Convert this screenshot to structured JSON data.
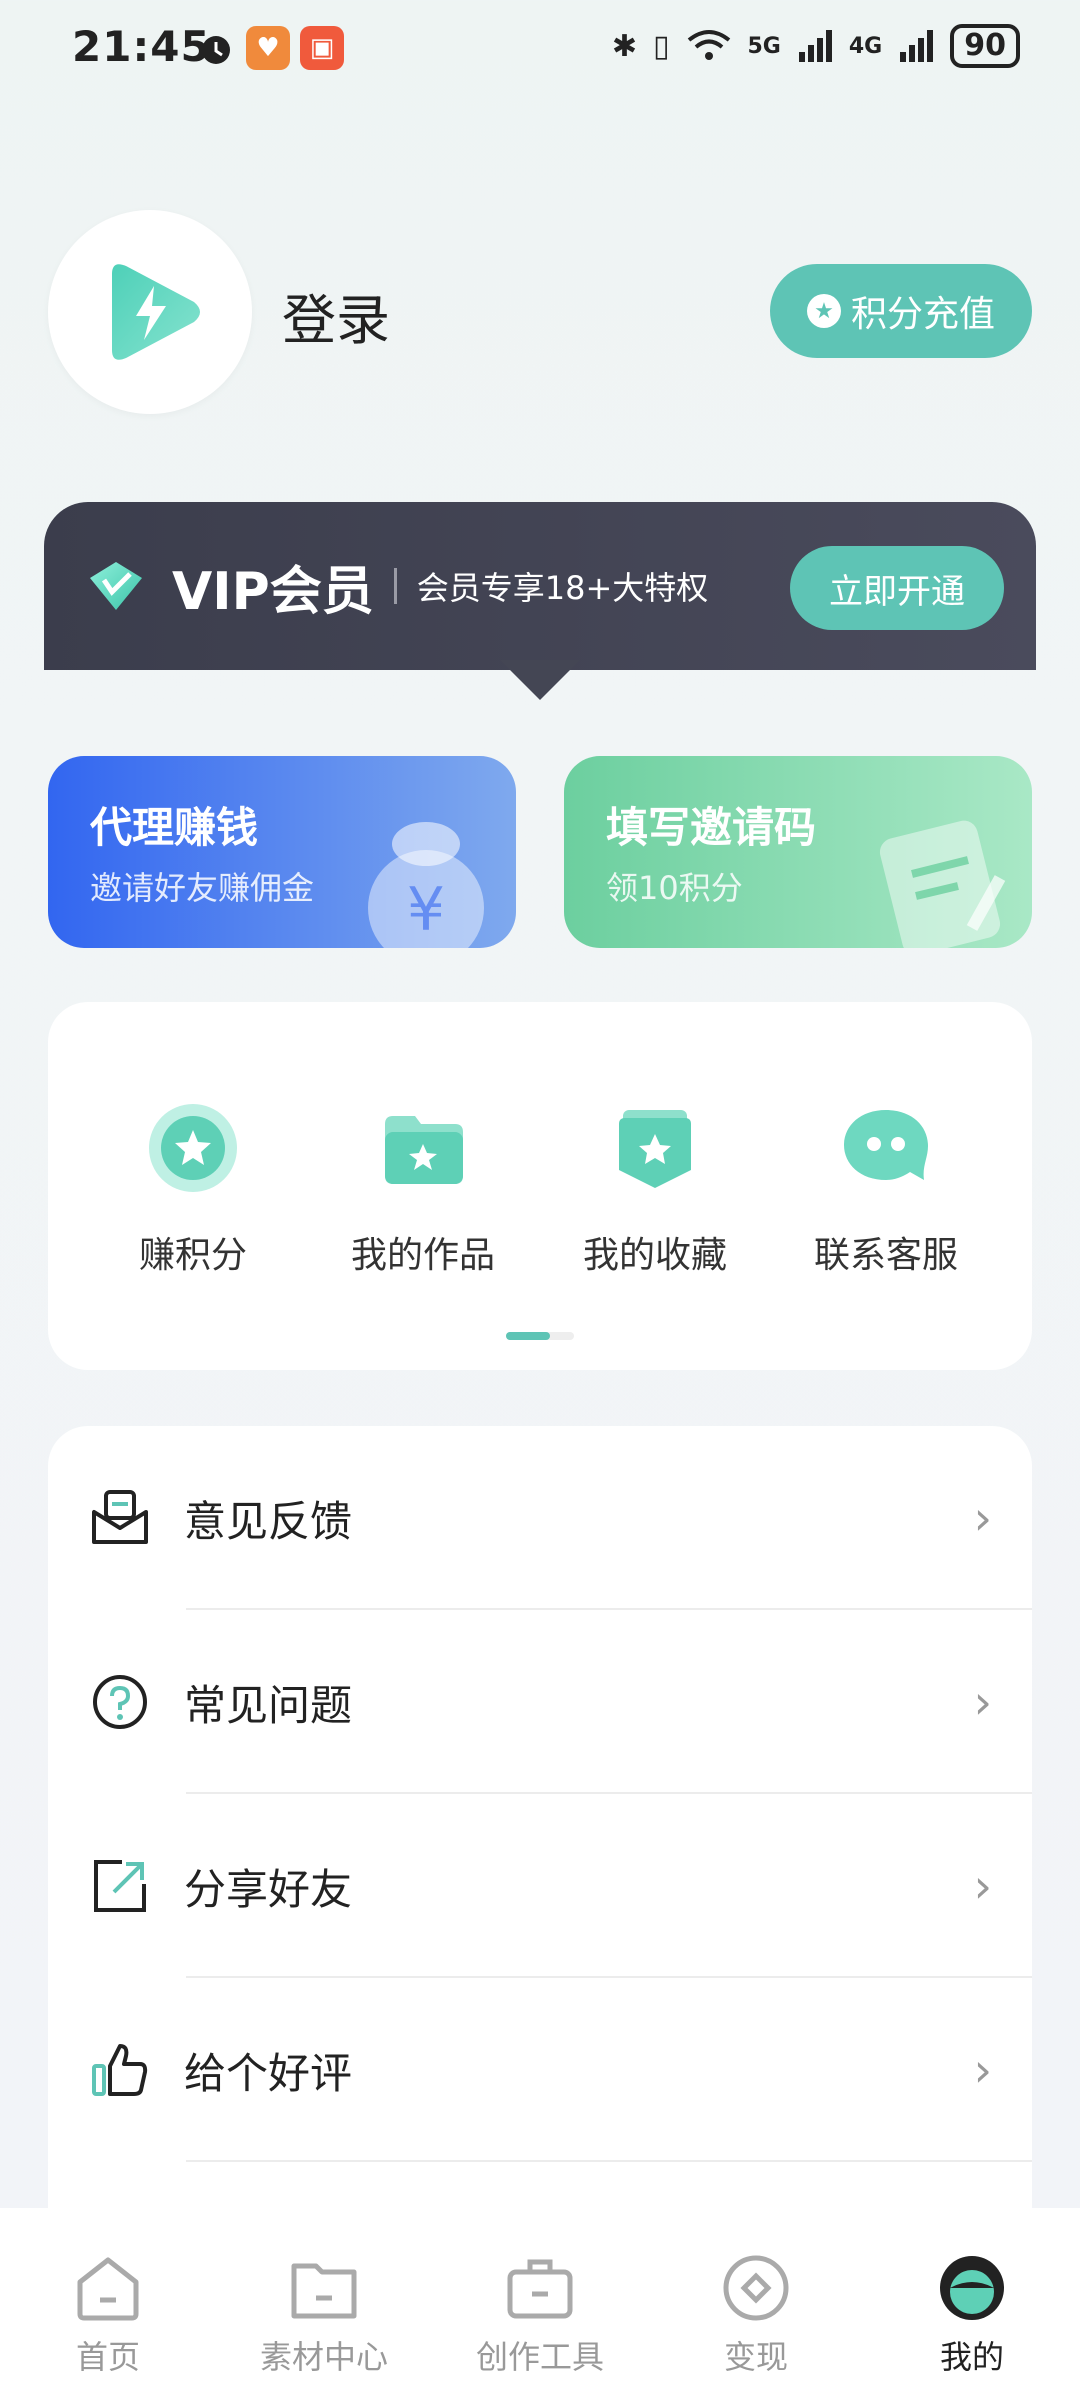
{
  "status_bar": {
    "time": "21:45",
    "battery": "90",
    "signal_5g": "5G",
    "signal_4g": "4G",
    "icons": [
      "alarm-icon",
      "app-badge-orange-icon",
      "app-badge-red-icon",
      "bluetooth-icon",
      "vibrate-icon",
      "wifi-icon"
    ]
  },
  "header": {
    "login_label": "登录",
    "recharge_label": "积分充值"
  },
  "vip": {
    "title": "VIP会员",
    "subtitle": "会员专享18+大特权",
    "button": "立即开通"
  },
  "promo": {
    "agent": {
      "title": "代理赚钱",
      "subtitle": "邀请好友赚佣金"
    },
    "invite": {
      "title": "填写邀请码",
      "subtitle": "领10积分"
    }
  },
  "quick_actions": [
    {
      "label": "赚积分",
      "icon": "star-medal-icon"
    },
    {
      "label": "我的作品",
      "icon": "folder-star-icon"
    },
    {
      "label": "我的收藏",
      "icon": "favorite-badge-icon"
    },
    {
      "label": "联系客服",
      "icon": "chat-bubble-icon"
    }
  ],
  "menu": [
    {
      "label": "意见反馈",
      "icon": "feedback-mail-icon"
    },
    {
      "label": "常见问题",
      "icon": "question-icon"
    },
    {
      "label": "分享好友",
      "icon": "share-icon"
    },
    {
      "label": "给个好评",
      "icon": "thumbs-up-icon"
    }
  ],
  "bottom_nav": [
    {
      "label": "首页",
      "icon": "home-icon",
      "active": false
    },
    {
      "label": "素材中心",
      "icon": "folder-icon",
      "active": false
    },
    {
      "label": "创作工具",
      "icon": "toolbox-icon",
      "active": false
    },
    {
      "label": "变现",
      "icon": "monetize-icon",
      "active": false
    },
    {
      "label": "我的",
      "icon": "profile-icon",
      "active": true
    }
  ],
  "colors": {
    "accent": "#5ec4b5",
    "vip_bg": "#3b3d4c",
    "agent_card": "#3266f0",
    "invite_card": "#6ccf9f"
  }
}
